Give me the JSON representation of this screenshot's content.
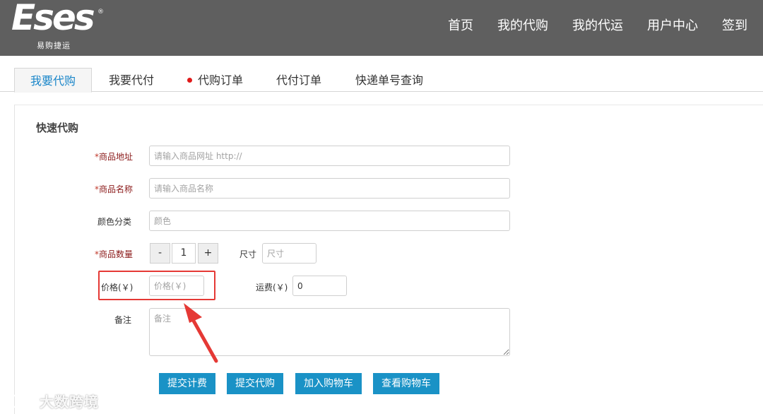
{
  "brand": {
    "logo_text": "Eses",
    "registered_mark": "®",
    "subtitle": "易购捷运"
  },
  "nav": [
    "首页",
    "我的代购",
    "我的代运",
    "用户中心",
    "签到"
  ],
  "tabs": [
    {
      "label": "我要代购",
      "active": true
    },
    {
      "label": "我要代付",
      "active": false
    },
    {
      "label": "代购订单",
      "active": false,
      "has_dot": true
    },
    {
      "label": "代付订单",
      "active": false
    },
    {
      "label": "快递单号查询",
      "active": false
    }
  ],
  "form": {
    "title": "快速代购",
    "required_mark": "*",
    "url": {
      "label": "商品地址",
      "placeholder": "请输入商品网址 http://",
      "value": ""
    },
    "name": {
      "label": "商品名称",
      "placeholder": "请输入商品名称",
      "value": ""
    },
    "color": {
      "label": "颜色分类",
      "placeholder": "颜色",
      "value": ""
    },
    "quantity": {
      "label": "商品数量",
      "minus": "-",
      "value": "1",
      "plus": "+"
    },
    "size": {
      "label": "尺寸",
      "placeholder": "尺寸",
      "value": ""
    },
    "price": {
      "label": "价格(￥)",
      "placeholder": "价格(￥)",
      "value": ""
    },
    "shipping": {
      "label": "运费(￥)",
      "placeholder": "",
      "value": "0"
    },
    "remark": {
      "label": "备注",
      "placeholder": "备注",
      "value": ""
    }
  },
  "actions": [
    "提交计费",
    "提交代购",
    "加入购物车",
    "查看购物车"
  ],
  "watermark": {
    "text": "大数跨境"
  },
  "colors": {
    "header_bg": "#5f5f5f",
    "accent": "#1a92c6",
    "tab_active_text": "#1a86c9",
    "highlight": "#e53935",
    "required": "#c0392b"
  },
  "icons": {
    "tab_dot": "red-dot-icon",
    "annotation": "red-arrow-icon",
    "watermark_logo": "watermark-logo-icon"
  }
}
